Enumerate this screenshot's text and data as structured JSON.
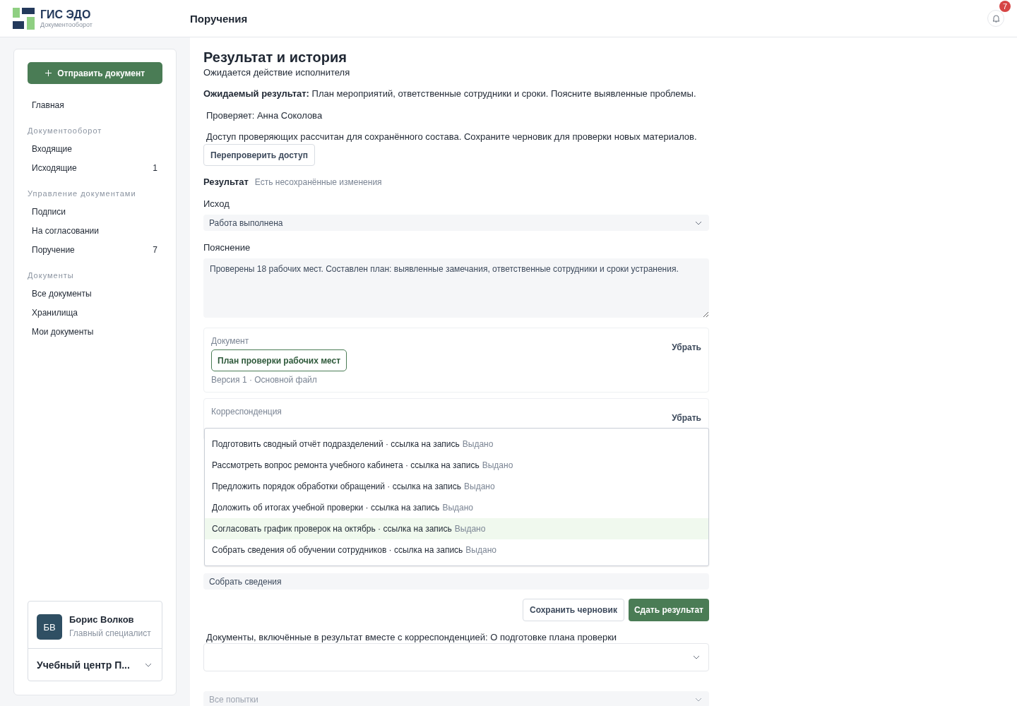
{
  "logo": {
    "title": "ГИС ЭДО",
    "subtitle": "Документооборот"
  },
  "header": {
    "title": "Поручения",
    "notifications": "7"
  },
  "sidebar": {
    "primary_button": "Отправить документ",
    "items": [
      {
        "kind": "item",
        "label": "Главная"
      },
      {
        "kind": "section",
        "label": "Документооборот"
      },
      {
        "kind": "item",
        "label": "Входящие"
      },
      {
        "kind": "item",
        "label": "Исходящие",
        "count": "1"
      },
      {
        "kind": "section",
        "label": "Управление документами"
      },
      {
        "kind": "item",
        "label": "Подписи"
      },
      {
        "kind": "item",
        "label": "На согласовании"
      },
      {
        "kind": "item",
        "label": "Поручение",
        "count": "7"
      },
      {
        "kind": "section",
        "label": "Документы"
      },
      {
        "kind": "item",
        "label": "Все документы"
      },
      {
        "kind": "item",
        "label": "Хранилища"
      },
      {
        "kind": "item",
        "label": "Мои документы"
      }
    ],
    "user": {
      "initials": "БВ",
      "name": "Борис Волков",
      "role": "Главный специалист",
      "organization": "Учебный центр П..."
    }
  },
  "main": {
    "title": "Результат и история",
    "status": "Ожидается действие исполнителя",
    "expected": "**Ожидаемый результат:** План мероприятий, ответственные сотрудники и сроки. Поясните выявленные проблемы.",
    "reviewer": "Проверяет: Анна Соколова",
    "access_note": "Доступ проверяющих рассчитан для сохранённого состава. Сохраните черновик для проверки новых материалов.",
    "recheck_button": "Перепроверить доступ",
    "result": {
      "heading": "Результат",
      "unsaved_note": "Есть несохранённые изменения"
    },
    "outcome": {
      "label": "Исход",
      "value": "Работа выполнена"
    },
    "explanation": {
      "label": "Пояснение",
      "value": "Проверены 18 рабочих мест. Составлен план: выявленные замечания, ответственные сотрудники и сроки устранения."
    },
    "attachments": [
      {
        "label": "Документ",
        "chip": "План проверки рабочих мест",
        "meta": "Версия 1 · Основной файл",
        "remove": "Убрать"
      },
      {
        "label": "Корреспонденция",
        "remove": "Убрать"
      }
    ],
    "search": {
      "value": "Собрать сведения",
      "suggestions": [
        {
          "title": "Подготовить сводный отчёт подразделений · ссылка на запись",
          "status": "Выдано",
          "selected": false
        },
        {
          "title": "Рассмотреть вопрос ремонта учебного кабинета · ссылка на запись",
          "status": "Выдано",
          "selected": false
        },
        {
          "title": "Предложить порядок обработки обращений · ссылка на запись",
          "status": "Выдано",
          "selected": false
        },
        {
          "title": "Доложить об итогах учебной проверки · ссылка на запись",
          "status": "Выдано",
          "selected": false
        },
        {
          "title": "Согласовать график проверок на октябрь · ссылка на запись",
          "status": "Выдано",
          "selected": true
        },
        {
          "title": "Собрать сведения об обучении сотрудников · ссылка на запись",
          "status": "Выдано",
          "selected": false
        }
      ]
    },
    "actions": {
      "save": "Сохранить черновик",
      "submit": "Сдать результат"
    },
    "included": {
      "label": "Документы, включённые в результат вместе с корреспонденцией: О подготовке плана проверки"
    },
    "attempts": {
      "placeholder": "Все попытки"
    }
  }
}
